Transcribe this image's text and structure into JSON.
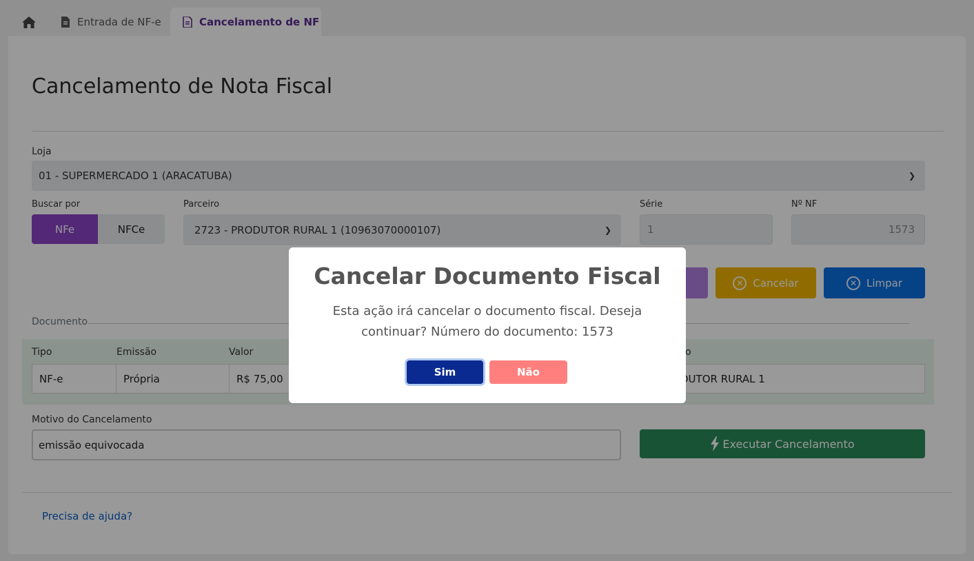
{
  "tabs": {
    "home_icon": "home-icon",
    "entrada": "Entrada de NF-e",
    "cancelamento": "Cancelamento de NF"
  },
  "page": {
    "title": "Cancelamento de Nota Fiscal"
  },
  "form": {
    "loja_label": "Loja",
    "loja_value": "01 - SUPERMERCADO 1 (ARACATUBA)",
    "buscar_label": "Buscar por",
    "buscar_options": [
      "NFe",
      "NFCe"
    ],
    "buscar_selected": "NFe",
    "parceiro_label": "Parceiro",
    "parceiro_value": "2723 - PRODUTOR RURAL 1 (10963070000107)",
    "serie_label": "Série",
    "serie_value": "1",
    "nnf_label": "Nº NF",
    "nnf_value": "1573"
  },
  "actions": {
    "buscar_partial": "r",
    "cancelar": "Cancelar",
    "limpar": "Limpar"
  },
  "documento": {
    "legend": "Documento",
    "headers": [
      "Tipo",
      "Emissão",
      "Valor",
      "o"
    ],
    "row": {
      "tipo": "NF-e",
      "emissao": "Própria",
      "valor": "R$ 75,00",
      "parceiro": "DUTOR RURAL 1"
    }
  },
  "motivo": {
    "label": "Motivo do Cancelamento",
    "value": "emissão equivocada"
  },
  "executar": "Executar Cancelamento",
  "help_link": "Precisa de ajuda?",
  "modal": {
    "title": "Cancelar Documento Fiscal",
    "text": "Esta ação irá cancelar o documento fiscal. Deseja continuar? Número do documento: 1573",
    "yes": "Sim",
    "no": "Não"
  },
  "colors": {
    "accent": "#8a44c7",
    "confirm": "#0b2a91",
    "deny": "#ff7f7f",
    "execute": "#2b8a5a"
  }
}
